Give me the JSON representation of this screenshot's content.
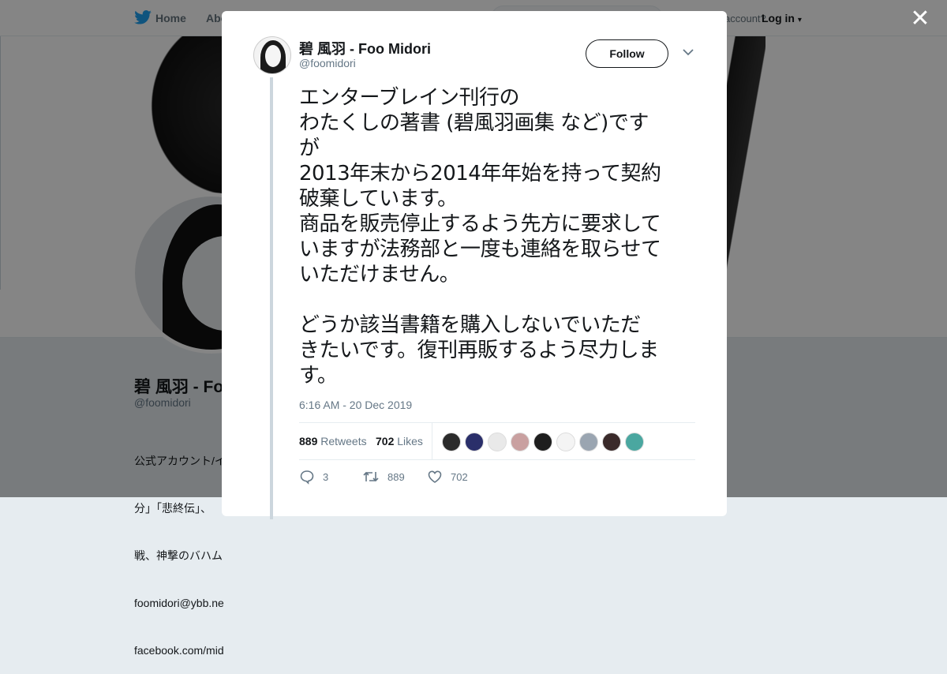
{
  "nav": {
    "home_label": "Home",
    "about_label": "Abo",
    "have_account_label": "account?",
    "login_label": "Log in"
  },
  "profile": {
    "name": "碧 風羽 - Foo",
    "handle": "@foomidori",
    "bio_lines": [
      "公式アカウント/イ",
      "分」「悲終伝」、",
      "戦、神撃のバハム",
      "foomidori@ybb.ne",
      "facebook.com/mid"
    ]
  },
  "tweet": {
    "author_name": "碧 風羽 - Foo Midori",
    "author_handle": "@foomidori",
    "follow_label": "Follow",
    "text": "エンターブレイン刊行の\nわたくしの著書 (碧風羽画集 など)です\nが\n2013年末から2014年年始を持って契約\n破棄しています。\n商品を販売停止するよう先方に要求して\nいますが法務部と一度も連絡を取らせて\nいただけません。\n\nどうか該当書籍を購入しないでいただ\nきたいです。復刊再販するよう尽力しま\nす。",
    "timestamp": "6:16 AM - 20 Dec 2019",
    "retweets_count": "889",
    "retweets_label": "Retweets",
    "likes_count": "702",
    "likes_label": "Likes",
    "reply_count": "3",
    "retweet_action_count": "889",
    "like_action_count": "702"
  },
  "liker_colors": [
    "#2b2b2b",
    "#2a2f6a",
    "#e9e9e9",
    "#c9a0a0",
    "#1e1e1e",
    "#f4f4f4",
    "#9aa5b1",
    "#3a2a2a",
    "#4aa7a0"
  ],
  "colors": {
    "accent": "#1da1f2",
    "text": "#14171a",
    "muted": "#657786"
  },
  "icons": [
    "twitter-bird-icon",
    "home-icon",
    "close-icon",
    "chevron-down-icon",
    "reply-icon",
    "retweet-icon",
    "heart-icon"
  ]
}
